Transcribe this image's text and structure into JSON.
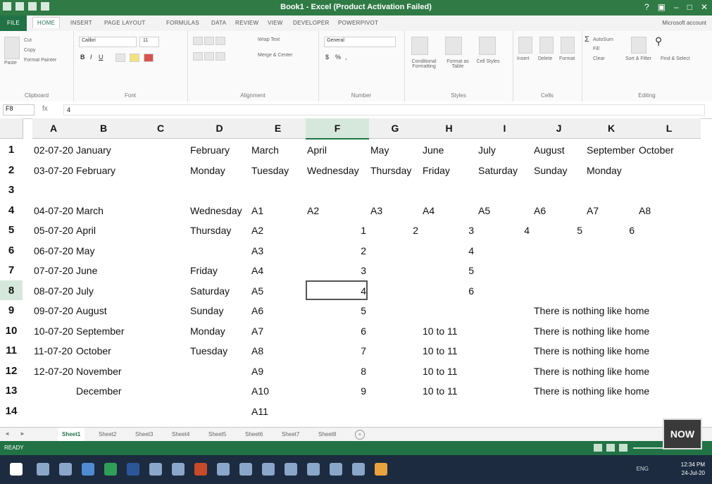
{
  "window": {
    "title": "Book1 - Excel (Product Activation Failed)"
  },
  "ribbon_tabs": [
    "FILE",
    "HOME",
    "INSERT",
    "PAGE LAYOUT",
    "FORMULAS",
    "DATA",
    "REVIEW",
    "VIEW",
    "DEVELOPER",
    "POWERPIVOT"
  ],
  "account": "Microsoft account",
  "ribbon": {
    "groups": [
      "Clipboard",
      "Font",
      "Alignment",
      "Number",
      "Styles",
      "Cells",
      "Editing"
    ],
    "paste": "Paste",
    "cut": "Cut",
    "copy": "Copy",
    "format_painter": "Format Painter",
    "font_name": "Calibri",
    "font_size": "11",
    "wrap_text": "Wrap Text",
    "merge_center": "Merge & Center",
    "number_format": "General",
    "conditional_formatting": "Conditional Formatting",
    "format_as_table": "Format as Table",
    "cell_styles": "Cell Styles",
    "insert": "Insert",
    "delete": "Delete",
    "format": "Format",
    "autosum": "AutoSum",
    "fill": "Fill",
    "clear": "Clear",
    "sort_filter": "Sort & Filter",
    "find_select": "Find & Select"
  },
  "formula_bar": {
    "name_box": "F8",
    "fx": "fx",
    "value": "4"
  },
  "columns": [
    "A",
    "B",
    "C",
    "D",
    "E",
    "F",
    "G",
    "H",
    "I",
    "J",
    "K",
    "L"
  ],
  "selected_column": "F",
  "rows": [
    "1",
    "2",
    "3",
    "4",
    "5",
    "6",
    "7",
    "8",
    "9",
    "10",
    "11",
    "12",
    "13",
    "14"
  ],
  "selected_row": "8",
  "cells": {
    "A1": "02-07-20",
    "B1": "January",
    "D1": "February",
    "E1": "March",
    "F1": "April",
    "G1": "May",
    "H1": "June",
    "I1": "July",
    "J1": "August",
    "K1": "September",
    "L1": "October",
    "A2": "03-07-20",
    "B2": "February",
    "D2": "Monday",
    "E2": "Tuesday",
    "F2": "Wednesday",
    "G2": "Thursday",
    "H2": "Friday",
    "I2": "Saturday",
    "J2": "Sunday",
    "K2": "Monday",
    "A4": "04-07-20",
    "B4": "March",
    "D4": "Wednesday",
    "E4": "A1",
    "F4": "A2",
    "G4": "A3",
    "H4": "A4",
    "I4": "A5",
    "J4": "A6",
    "K4": "A7",
    "L4": "A8",
    "A5": "05-07-20",
    "B5": "April",
    "D5": "Thursday",
    "E5": "A2",
    "F5": "1",
    "G5": "2",
    "H5": "3",
    "I5": "4",
    "J5": "5",
    "K5": "6",
    "A6": "06-07-20",
    "B6": "May",
    "E6": "A3",
    "F6": "2",
    "H6": "4",
    "A7": "07-07-20",
    "B7": "June",
    "D7": "Friday",
    "E7": "A4",
    "F7": "3",
    "H7": "5",
    "A8": "08-07-20",
    "B8": "July",
    "D8": "Saturday",
    "E8": "A5",
    "F8": "4",
    "H8": "6",
    "A9": "09-07-20",
    "B9": "August",
    "D9": "Sunday",
    "E9": "A6",
    "F9": "5",
    "J9": "There is nothing like home",
    "A10": "10-07-20",
    "B10": "September",
    "D10": "Monday",
    "E10": "A7",
    "F10": "6",
    "H10": "10 to 11",
    "J10": "There is nothing like home",
    "A11": "11-07-20",
    "B11": "October",
    "D11": "Tuesday",
    "E11": "A8",
    "F11": "7",
    "H11": "10 to 11",
    "J11": "There is nothing like home",
    "A12": "12-07-20",
    "B12": "November",
    "E12": "A9",
    "F12": "8",
    "H12": "10 to 11",
    "J12": "There is nothing like home",
    "B13": "December",
    "E13": "A10",
    "F13": "9",
    "H13": "10 to 11",
    "J13": "There is nothing like home",
    "E14": "A11"
  },
  "sheets": [
    "Sheet1",
    "Sheet2",
    "Sheet3",
    "Sheet4",
    "Sheet5",
    "Sheet6",
    "Sheet7",
    "Sheet8"
  ],
  "active_sheet": "Sheet1",
  "status": {
    "ready": "READY"
  },
  "badge": "NOW",
  "taskbar": {
    "time": "12:34 PM",
    "date": "24-Jul-20",
    "lang": "ENG"
  }
}
